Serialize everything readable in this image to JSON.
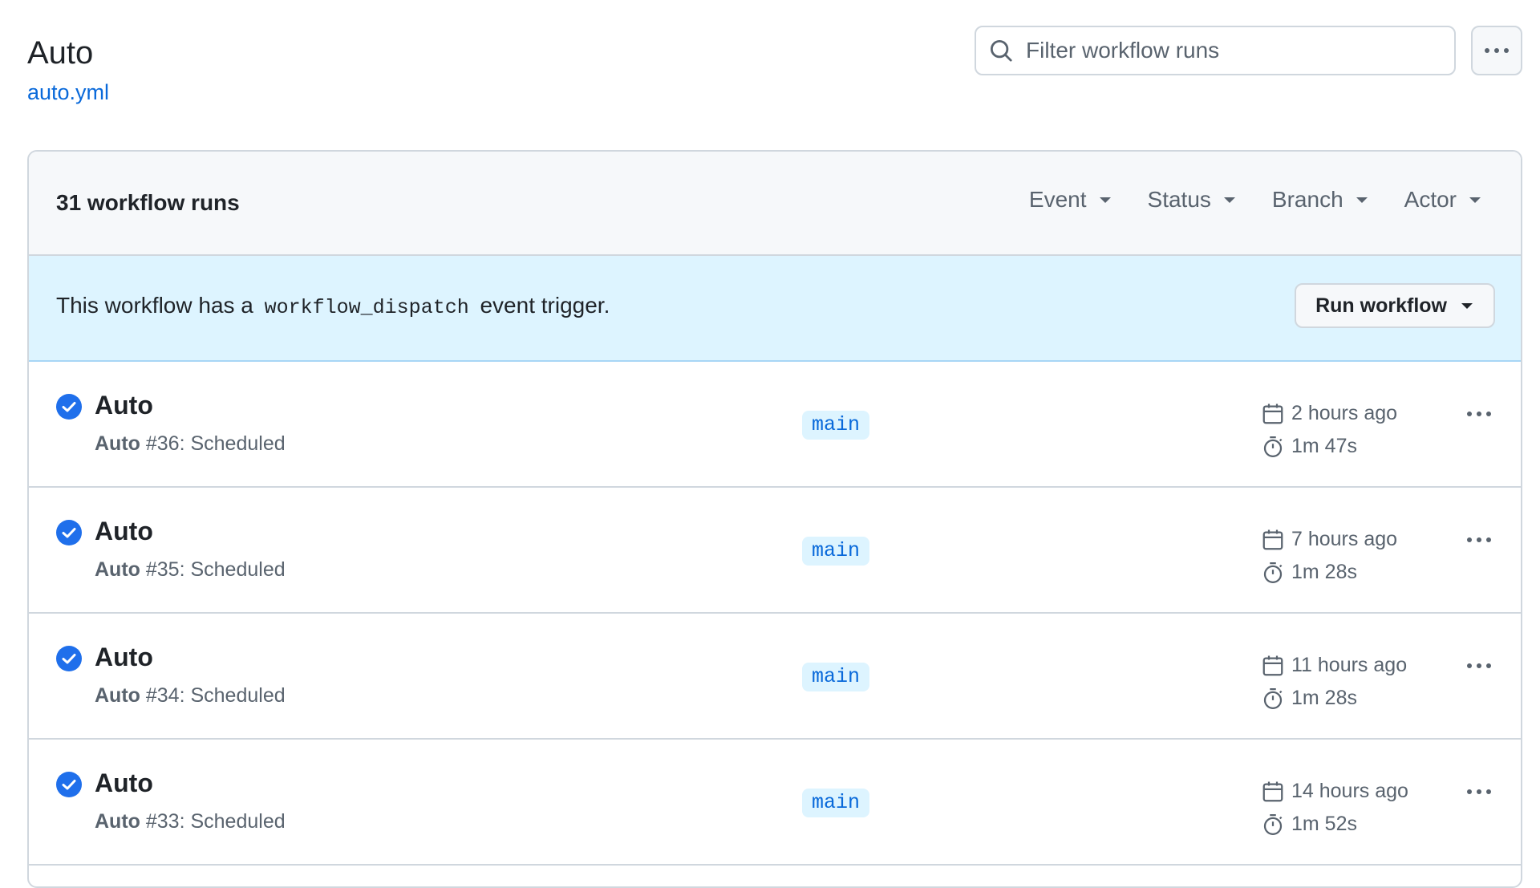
{
  "header": {
    "title": "Auto",
    "file_link": "auto.yml",
    "search_placeholder": "Filter workflow runs"
  },
  "list": {
    "count_label": "31 workflow runs",
    "filters": [
      "Event",
      "Status",
      "Branch",
      "Actor"
    ]
  },
  "banner": {
    "text_before": "This workflow has a",
    "code": "workflow_dispatch",
    "text_after": "event trigger.",
    "button_label": "Run workflow"
  },
  "runs": [
    {
      "title": "Auto",
      "name": "Auto",
      "number_suffix": " #36: Scheduled",
      "branch": "main",
      "when": "2 hours ago",
      "duration": "1m 47s",
      "status": "success"
    },
    {
      "title": "Auto",
      "name": "Auto",
      "number_suffix": " #35: Scheduled",
      "branch": "main",
      "when": "7 hours ago",
      "duration": "1m 28s",
      "status": "success"
    },
    {
      "title": "Auto",
      "name": "Auto",
      "number_suffix": " #34: Scheduled",
      "branch": "main",
      "when": "11 hours ago",
      "duration": "1m 28s",
      "status": "success"
    },
    {
      "title": "Auto",
      "name": "Auto",
      "number_suffix": " #33: Scheduled",
      "branch": "main",
      "when": "14 hours ago",
      "duration": "1m 52s",
      "status": "success"
    }
  ],
  "colors": {
    "accent": "#0969da",
    "success_check": "#1f6feb",
    "banner_bg": "#ddf4ff"
  }
}
